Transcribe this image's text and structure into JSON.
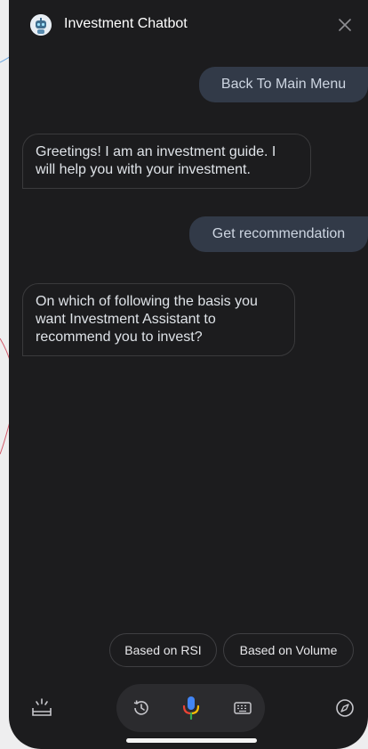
{
  "header": {
    "title": "Investment Chatbot",
    "avatar_icon": "robot-avatar-icon",
    "close_icon": "close-icon"
  },
  "messages": [
    {
      "sender": "user",
      "text": "Back To Main Menu"
    },
    {
      "sender": "bot",
      "text": "Greetings! I am an investment guide. I will help you with your investment."
    },
    {
      "sender": "user",
      "text": "Get recommendation"
    },
    {
      "sender": "bot",
      "text": "On which of following the basis you want Investment Assistant to recommend you to invest?"
    }
  ],
  "suggestions": [
    {
      "label": "Based on RSI"
    },
    {
      "label": "Based on Volume"
    }
  ],
  "toolbar": {
    "left_icon": "snapshot-icon",
    "history_icon": "history-icon",
    "mic_icon": "microphone-icon",
    "keyboard_icon": "keyboard-icon",
    "right_icon": "compass-icon"
  },
  "colors": {
    "background": "#1c1c1e",
    "user_bubble": "#323a48",
    "bot_border": "#3a3a3c",
    "chip_border": "#3f3f42",
    "mic_blue": "#4285f4",
    "mic_red": "#ea4335",
    "mic_yellow": "#fbbc05",
    "mic_green": "#34a853"
  }
}
